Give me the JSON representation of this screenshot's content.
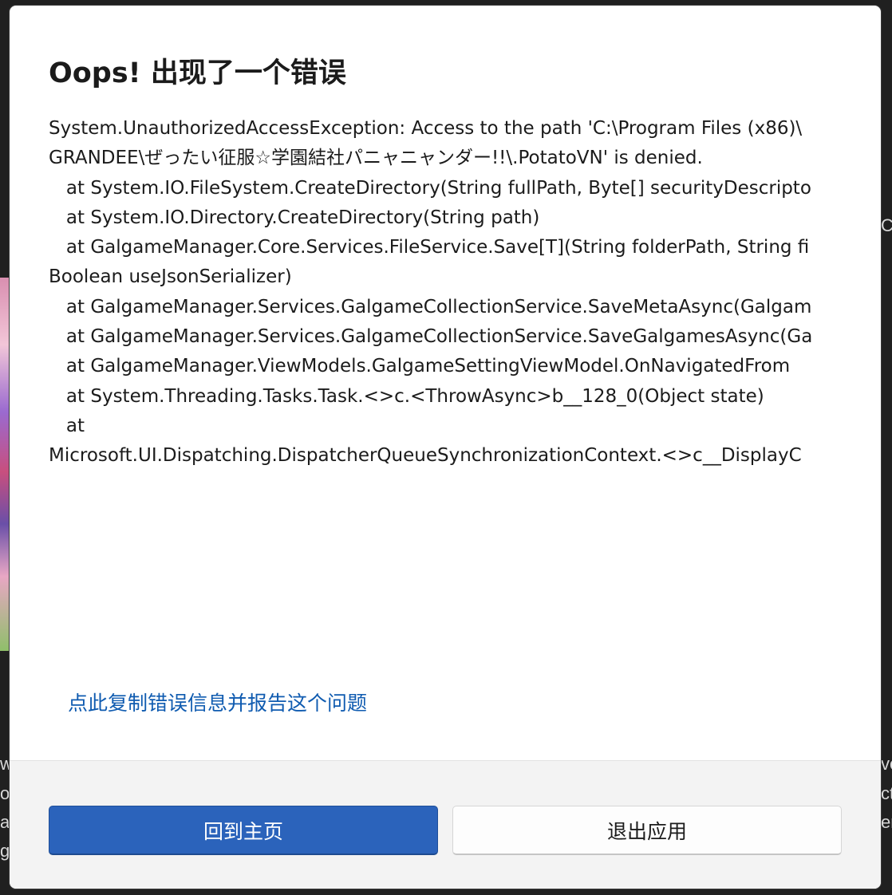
{
  "dialog": {
    "title": "Oops! 出现了一个错误",
    "error_lines": [
      "System.UnauthorizedAccessException: Access to the path 'C:\\Program Files (x86)\\",
      "GRANDEE\\ぜったい征服☆学園結社パニャニャンダー!!\\.PotatoVN' is denied.",
      "   at System.IO.FileSystem.CreateDirectory(String fullPath, Byte[] securityDescripto",
      "   at System.IO.Directory.CreateDirectory(String path)",
      "   at GalgameManager.Core.Services.FileService.Save[T](String folderPath, String fi",
      "Boolean useJsonSerializer)",
      "   at GalgameManager.Services.GalgameCollectionService.SaveMetaAsync(Galgam",
      "   at GalgameManager.Services.GalgameCollectionService.SaveGalgamesAsync(Ga",
      "   at GalgameManager.ViewModels.GalgameSettingViewModel.OnNavigatedFrom",
      "   at System.Threading.Tasks.Task.<>c.<ThrowAsync>b__128_0(Object state)",
      "   at",
      "Microsoft.UI.Dispatching.DispatcherQueueSynchronizationContext.<>c__DisplayC"
    ],
    "report_link": "点此复制错误信息并报告这个问题",
    "primary_button": "回到主页",
    "secondary_button": "退出应用"
  },
  "background": {
    "right_fragments": [
      "Co",
      "ve",
      "cti",
      "er"
    ],
    "left_fragments": [
      "w",
      "o",
      "a",
      "g"
    ]
  },
  "colors": {
    "accent": "#2b63bb",
    "link": "#0f5bb0",
    "footer": "#f3f3f3",
    "backdrop": "#202020"
  }
}
